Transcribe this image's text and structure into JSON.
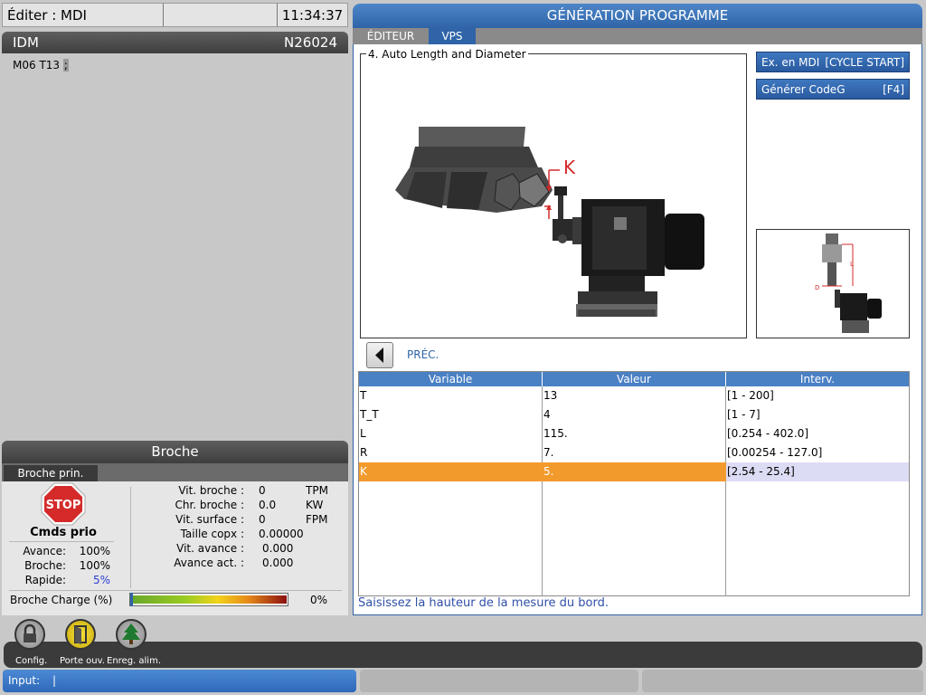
{
  "title_bar": {
    "mode": "Éditer : MDI",
    "time": "11:34:37"
  },
  "idm": {
    "title": "IDM",
    "program": "N26024",
    "line_text": "M06 T13",
    "cursor_char": ";"
  },
  "broche": {
    "title": "Broche",
    "tab": "Broche prin.",
    "stop_label": "STOP",
    "cmds_prio": "Cmds prio",
    "overrides": [
      {
        "label": "Avance:",
        "value": "100%"
      },
      {
        "label": "Broche:",
        "value": "100%"
      },
      {
        "label": "Rapide:",
        "value": "5%"
      }
    ],
    "spindle": [
      {
        "label": "Vit. broche :",
        "value": "0",
        "unit": "TPM"
      },
      {
        "label": "Chr. broche :",
        "value": "0.0",
        "unit": "KW"
      },
      {
        "label": "Vit. surface :",
        "value": "0",
        "unit": "FPM"
      },
      {
        "label": "Taille copx :",
        "value": "0.00000",
        "unit": ""
      },
      {
        "label": "Vit. avance :",
        "value": "0.000",
        "unit": ""
      },
      {
        "label": "Avance act. :",
        "value": "0.000",
        "unit": ""
      }
    ],
    "charge_label": "Broche Charge (%)",
    "charge_value": "0%",
    "charge_level": 0
  },
  "gen": {
    "title": "GÉNÉRATION PROGRAMME",
    "tabs": [
      "ÉDITEUR",
      "VPS"
    ],
    "figure_title": "4. Auto Length and Diameter",
    "k_label": "K",
    "thumb_l": "L",
    "thumb_d": "D",
    "buttons": [
      {
        "label": "Ex. en MDI",
        "key": "[CYCLE START]"
      },
      {
        "label": "Générer CodeG",
        "key": "[F4]"
      }
    ],
    "prev_label": "PRÉC.",
    "table": {
      "headers": [
        "Variable",
        "Valeur",
        "Interv."
      ],
      "rows": [
        [
          "T",
          "13",
          "[1 - 200]"
        ],
        [
          "T_T",
          "4",
          "[1 - 7]"
        ],
        [
          "L",
          "115.",
          "[0.254 - 402.0]"
        ],
        [
          "R",
          "7.",
          "[0.00254 - 127.0]"
        ],
        [
          "K",
          "5.",
          "[2.54 - 25.4]"
        ]
      ],
      "selected_row": 4
    },
    "hint": "Saisissez la hauteur de la mesure du bord."
  },
  "bottom": {
    "icons": [
      {
        "name": "lock-icon",
        "label": "Config."
      },
      {
        "name": "door-icon",
        "label": "Porte ouv."
      },
      {
        "name": "tree-icon",
        "label": "Enreg. alim."
      }
    ],
    "input_label": "Input:",
    "input_value": "|"
  },
  "colors": {
    "accent": "#2f64a8",
    "selected": "#f39a2d",
    "stop": "#d42a2a"
  }
}
